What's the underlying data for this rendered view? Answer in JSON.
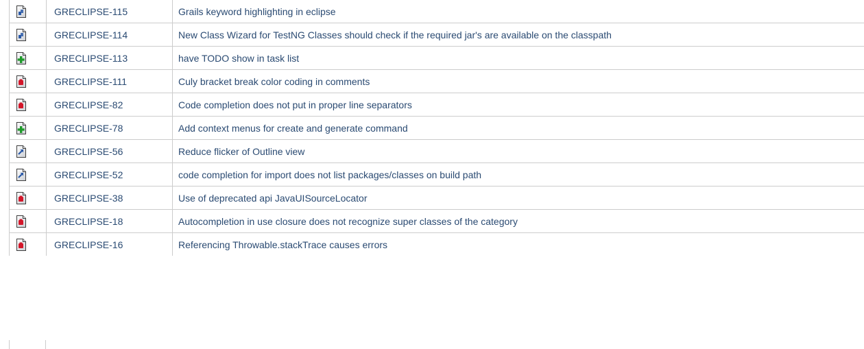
{
  "colors": {
    "link": "#2a4a72",
    "border": "#cccccc",
    "task_blue": "#2b5aa8",
    "feature_green": "#1f9a2a",
    "bug_red": "#d3172a"
  },
  "issues": [
    {
      "icon": "task-icon",
      "key": "GRECLIPSE-115",
      "summary": "Grails keyword highlighting in eclipse"
    },
    {
      "icon": "task-icon",
      "key": "GRECLIPSE-114",
      "summary": "New Class Wizard for TestNG Classes should check if the required jar's are available on the classpath"
    },
    {
      "icon": "new-feature-icon",
      "key": "GRECLIPSE-113",
      "summary": "have TODO show in task list"
    },
    {
      "icon": "bug-icon",
      "key": "GRECLIPSE-111",
      "summary": "Culy bracket break color coding in comments"
    },
    {
      "icon": "bug-icon",
      "key": "GRECLIPSE-82",
      "summary": "Code completion does not put in proper line separators"
    },
    {
      "icon": "new-feature-icon",
      "key": "GRECLIPSE-78",
      "summary": "Add context menus for create and generate command"
    },
    {
      "icon": "improvement-icon",
      "key": "GRECLIPSE-56",
      "summary": "Reduce flicker of Outline view"
    },
    {
      "icon": "improvement-icon",
      "key": "GRECLIPSE-52",
      "summary": "code completion for import does not list packages/classes on build path"
    },
    {
      "icon": "bug-icon",
      "key": "GRECLIPSE-38",
      "summary": "Use of deprecated api JavaUISourceLocator"
    },
    {
      "icon": "bug-icon",
      "key": "GRECLIPSE-18",
      "summary": "Autocompletion in use closure does not recognize super classes of the category"
    },
    {
      "icon": "bug-icon",
      "key": "GRECLIPSE-16",
      "summary": "Referencing Throwable.stackTrace causes errors"
    }
  ]
}
